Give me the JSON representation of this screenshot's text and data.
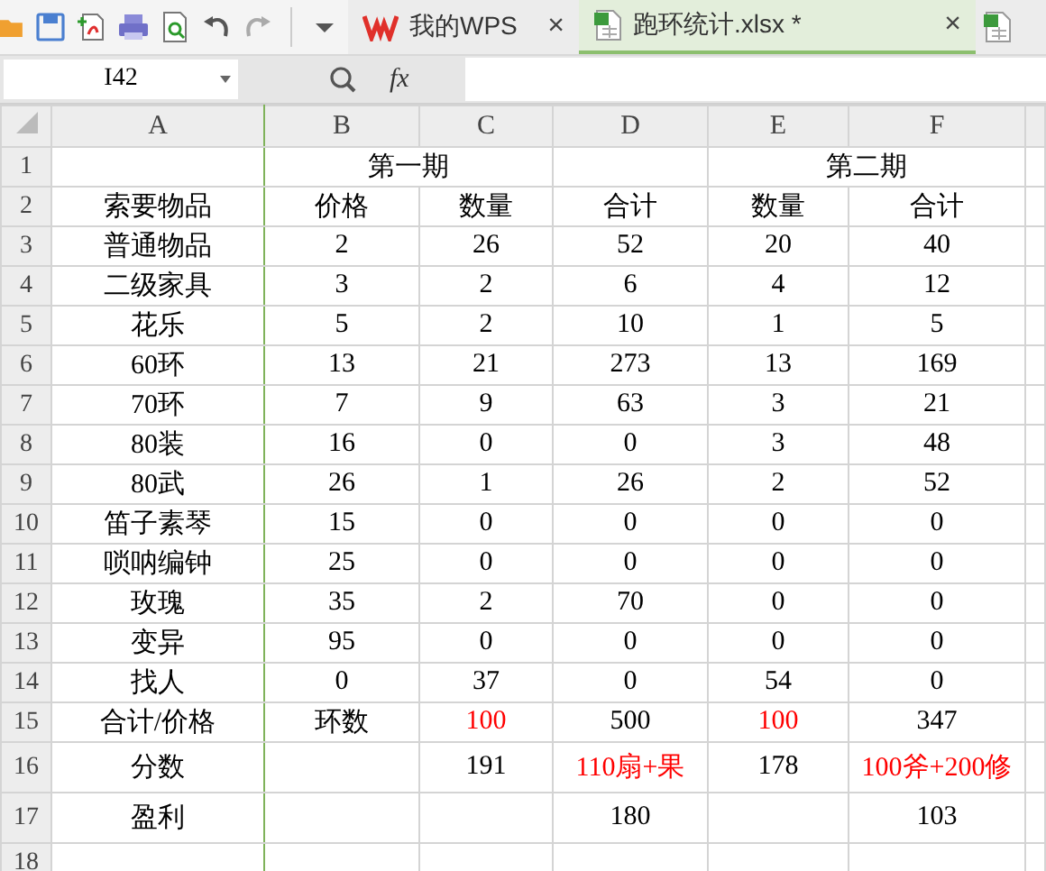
{
  "tabs": [
    {
      "label": "我的WPS",
      "kind": "wps",
      "close": "×",
      "selected": false
    },
    {
      "label": "跑环统计.xlsx *",
      "kind": "sheet",
      "close": "×",
      "selected": true
    },
    {
      "kind": "sheet-partial",
      "selected": false
    }
  ],
  "formula_bar": {
    "name_box": "I42",
    "fx": "fx"
  },
  "columns": [
    "A",
    "B",
    "C",
    "D",
    "E",
    "F"
  ],
  "rows": [
    {
      "number": "1",
      "kind": "group-header",
      "cells": [
        null,
        "第一期",
        null,
        null,
        "第二期",
        null
      ]
    },
    {
      "number": "2",
      "cells": [
        "索要物品",
        "价格",
        "数量",
        "合计",
        "数量",
        "合计"
      ]
    },
    {
      "number": "3",
      "cells": [
        "普通物品",
        "2",
        "26",
        "52",
        "20",
        "40"
      ]
    },
    {
      "number": "4",
      "cells": [
        "二级家具",
        "3",
        "2",
        "6",
        "4",
        "12"
      ]
    },
    {
      "number": "5",
      "cells": [
        "花乐",
        "5",
        "2",
        "10",
        "1",
        "5"
      ]
    },
    {
      "number": "6",
      "cells": [
        "60环",
        "13",
        "21",
        "273",
        "13",
        "169"
      ]
    },
    {
      "number": "7",
      "cells": [
        "70环",
        "7",
        "9",
        "63",
        "3",
        "21"
      ]
    },
    {
      "number": "8",
      "cells": [
        "80装",
        "16",
        "0",
        "0",
        "3",
        "48"
      ]
    },
    {
      "number": "9",
      "cells": [
        "80武",
        "26",
        "1",
        "26",
        "2",
        "52"
      ]
    },
    {
      "number": "10",
      "cells": [
        "笛子素琴",
        "15",
        "0",
        "0",
        "0",
        "0"
      ]
    },
    {
      "number": "11",
      "cells": [
        "唢呐编钟",
        "25",
        "0",
        "0",
        "0",
        "0"
      ]
    },
    {
      "number": "12",
      "cells": [
        "玫瑰",
        "35",
        "2",
        "70",
        "0",
        "0"
      ]
    },
    {
      "number": "13",
      "cells": [
        "变异",
        "95",
        "0",
        "0",
        "0",
        "0"
      ]
    },
    {
      "number": "14",
      "cells": [
        "找人",
        "0",
        "37",
        "0",
        "54",
        "0"
      ]
    },
    {
      "number": "15",
      "cells": [
        "合计/价格",
        "环数",
        {
          "text": "100",
          "color": "#ff0000"
        },
        "500",
        {
          "text": "100",
          "color": "#ff0000"
        },
        "347"
      ]
    },
    {
      "number": "16",
      "cells": [
        "分数",
        null,
        "191",
        {
          "text": "110扇+果",
          "color": "#ff0000"
        },
        "178",
        {
          "text": "100斧+200修",
          "color": "#ff0000"
        }
      ]
    },
    {
      "number": "17",
      "cells": [
        "盈利",
        null,
        null,
        "180",
        null,
        "103"
      ]
    },
    {
      "number": "18",
      "cells": [
        null,
        null,
        null,
        null,
        null,
        null
      ]
    }
  ]
}
